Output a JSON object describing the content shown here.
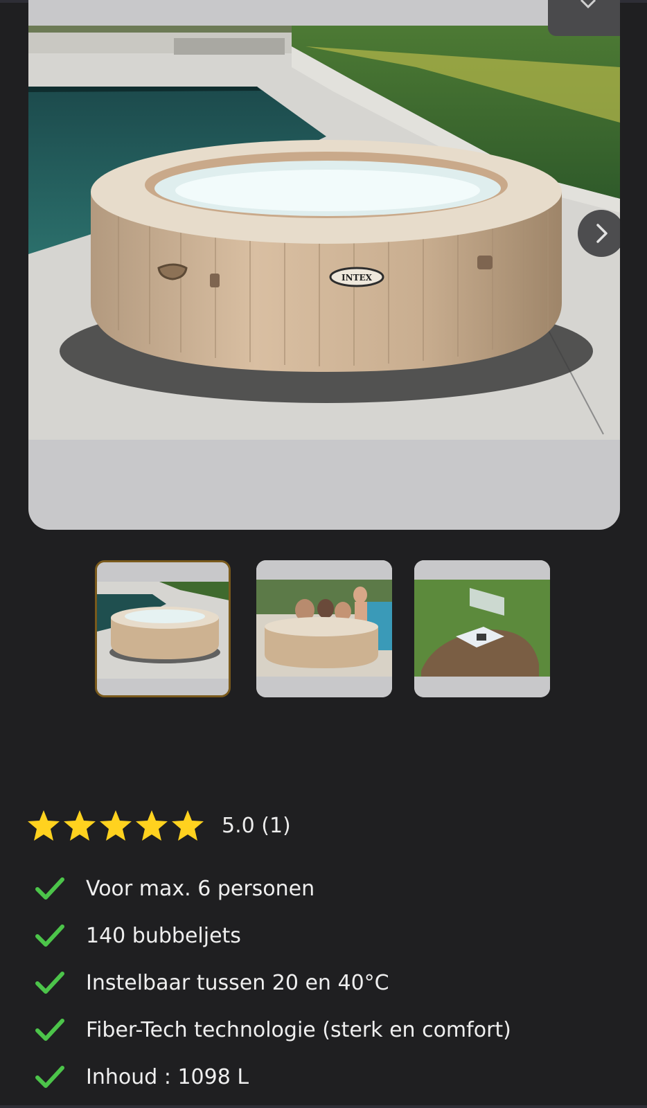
{
  "gallery": {
    "main_image": "intex-hot-tub-poolside-photo",
    "collapse_icon": "chevron-down-icon",
    "next_icon": "chevron-right-icon",
    "thumbnails": [
      {
        "image": "hot-tub-poolside-thumbnail",
        "active": true
      },
      {
        "image": "hot-tub-with-people-thumbnail",
        "active": false
      },
      {
        "image": "hot-tub-cover-on-lawn-thumbnail",
        "active": false
      }
    ],
    "brand_logo_text": "INTEX"
  },
  "rating": {
    "stars": 5,
    "max_stars": 5,
    "text": "5.0 (1)",
    "star_color": "#ffd21f"
  },
  "features": [
    {
      "icon": "check-icon",
      "label": "Voor max. 6 personen"
    },
    {
      "icon": "check-icon",
      "label": "140 bubbeljets"
    },
    {
      "icon": "check-icon",
      "label": "Instelbaar tussen 20 en 40°C"
    },
    {
      "icon": "check-icon",
      "label": "Fiber-Tech technologie (sterk en comfort)"
    },
    {
      "icon": "check-icon",
      "label": "Inhoud : 1098 L"
    }
  ],
  "colors": {
    "background": "#1f1f21",
    "check": "#4cc44a",
    "active_thumb_border": "#7a5a1c"
  }
}
